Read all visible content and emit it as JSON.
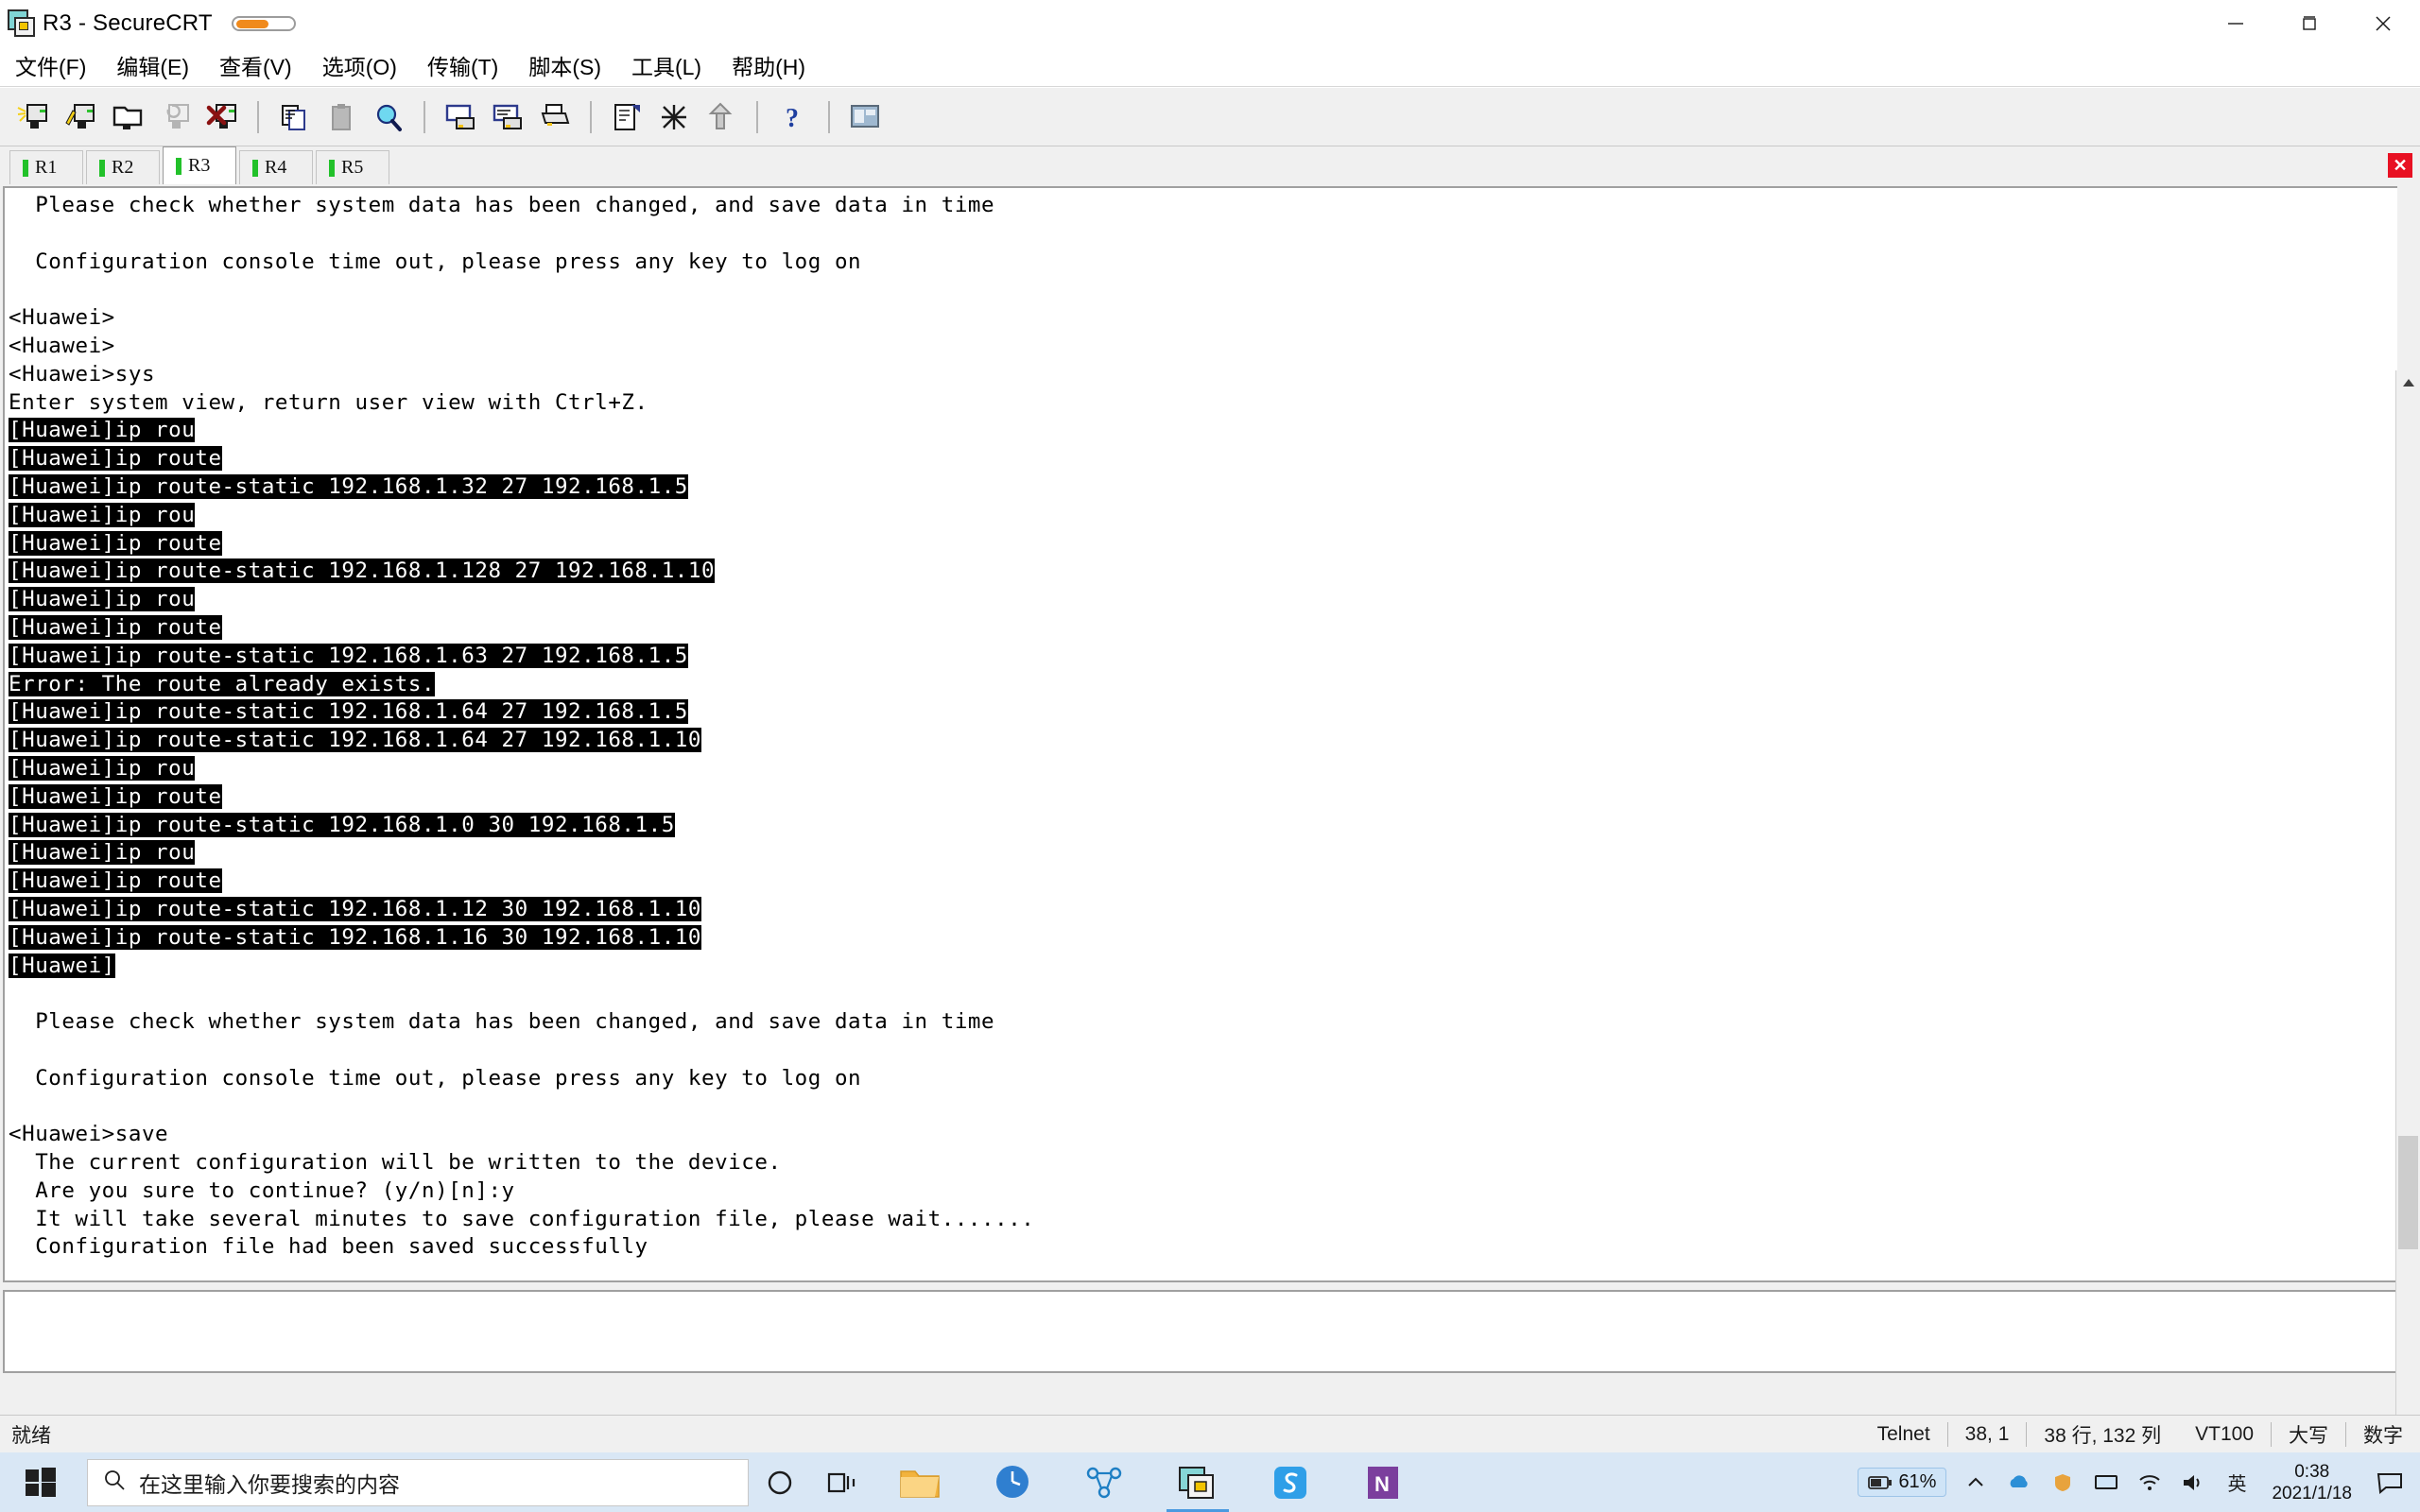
{
  "window": {
    "title": "R3 - SecureCRT",
    "app_icon": "securecrt-icon",
    "minimize": "—",
    "maximize": "❐",
    "close": "✕"
  },
  "menubar": {
    "items": [
      {
        "label": "文件(F)",
        "name": "menu-file"
      },
      {
        "label": "编辑(E)",
        "name": "menu-edit"
      },
      {
        "label": "查看(V)",
        "name": "menu-view"
      },
      {
        "label": "选项(O)",
        "name": "menu-options"
      },
      {
        "label": "传输(T)",
        "name": "menu-transfer"
      },
      {
        "label": "脚本(S)",
        "name": "menu-script"
      },
      {
        "label": "工具(L)",
        "name": "menu-tools"
      },
      {
        "label": "帮助(H)",
        "name": "menu-help"
      }
    ]
  },
  "toolbar": {
    "buttons": [
      "new-session-icon",
      "quick-connect-icon",
      "open-session-folder-icon",
      "reconnect-icon",
      "disconnect-icon",
      "copy-icon",
      "paste-icon",
      "find-icon",
      "log-session-icon",
      "print-screen-icon",
      "print-icon",
      "session-options-icon",
      "global-options-icon",
      "upload-icon",
      "help-icon",
      "tile-windows-icon"
    ]
  },
  "tabs": {
    "items": [
      {
        "label": "R1",
        "active": false
      },
      {
        "label": "R2",
        "active": false
      },
      {
        "label": "R3",
        "active": true
      },
      {
        "label": "R4",
        "active": false
      },
      {
        "label": "R5",
        "active": false
      }
    ],
    "close_label": "✕"
  },
  "terminal": {
    "lines": [
      {
        "text": "  Please check whether system data has been changed, and save data in time",
        "inv": false
      },
      {
        "text": "",
        "inv": false
      },
      {
        "text": "  Configuration console time out, please press any key to log on",
        "inv": false
      },
      {
        "text": "",
        "inv": false
      },
      {
        "text": "<Huawei>",
        "inv": false
      },
      {
        "text": "<Huawei>",
        "inv": false
      },
      {
        "text": "<Huawei>sys",
        "inv": false
      },
      {
        "text": "Enter system view, return user view with Ctrl+Z.",
        "inv": false
      },
      {
        "text": "[Huawei]ip rou",
        "inv": true
      },
      {
        "text": "[Huawei]ip route",
        "inv": true
      },
      {
        "text": "[Huawei]ip route-static 192.168.1.32 27 192.168.1.5",
        "inv": true
      },
      {
        "text": "[Huawei]ip rou",
        "inv": true
      },
      {
        "text": "[Huawei]ip route",
        "inv": true
      },
      {
        "text": "[Huawei]ip route-static 192.168.1.128 27 192.168.1.10",
        "inv": true
      },
      {
        "text": "[Huawei]ip rou",
        "inv": true
      },
      {
        "text": "[Huawei]ip route",
        "inv": true
      },
      {
        "text": "[Huawei]ip route-static 192.168.1.63 27 192.168.1.5",
        "inv": true
      },
      {
        "text": "Error: The route already exists.",
        "inv": true
      },
      {
        "text": "[Huawei]ip route-static 192.168.1.64 27 192.168.1.5",
        "inv": true
      },
      {
        "text": "[Huawei]ip route-static 192.168.1.64 27 192.168.1.10",
        "inv": true
      },
      {
        "text": "[Huawei]ip rou",
        "inv": true
      },
      {
        "text": "[Huawei]ip route",
        "inv": true
      },
      {
        "text": "[Huawei]ip route-static 192.168.1.0 30 192.168.1.5",
        "inv": true
      },
      {
        "text": "[Huawei]ip rou",
        "inv": true
      },
      {
        "text": "[Huawei]ip route",
        "inv": true
      },
      {
        "text": "[Huawei]ip route-static 192.168.1.12 30 192.168.1.10",
        "inv": true
      },
      {
        "text": "[Huawei]ip route-static 192.168.1.16 30 192.168.1.10",
        "inv": true
      },
      {
        "text": "[Huawei]",
        "inv": true
      },
      {
        "text": "",
        "inv": false
      },
      {
        "text": "  Please check whether system data has been changed, and save data in time",
        "inv": false
      },
      {
        "text": "",
        "inv": false
      },
      {
        "text": "  Configuration console time out, please press any key to log on",
        "inv": false
      },
      {
        "text": "",
        "inv": false
      },
      {
        "text": "<Huawei>save",
        "inv": false
      },
      {
        "text": "  The current configuration will be written to the device.",
        "inv": false
      },
      {
        "text": "  Are you sure to continue? (y/n)[n]:y",
        "inv": false
      },
      {
        "text": "  It will take several minutes to save configuration file, please wait.......",
        "inv": false
      },
      {
        "text": "  Configuration file had been saved successfully",
        "inv": false
      }
    ]
  },
  "statusbar": {
    "ready": "就绪",
    "protocol": "Telnet",
    "cursor": "38,  1",
    "dimensions": "38 行, 132 列",
    "emulation": "VT100",
    "caps": "大写",
    "num": "数字"
  },
  "taskbar": {
    "start": "windows-start-icon",
    "search_placeholder": "在这里输入你要搜索的内容",
    "cortana": "cortana-icon",
    "taskview": "task-view-icon",
    "apps": [
      {
        "name": "file-explorer-icon",
        "active": false
      },
      {
        "name": "clock-app-icon",
        "active": false
      },
      {
        "name": "ensp-icon",
        "active": false
      },
      {
        "name": "securecrt-icon",
        "active": true
      },
      {
        "name": "snipaste-icon",
        "active": false
      },
      {
        "name": "onenote-icon",
        "active": false
      }
    ],
    "battery_percent": "61%",
    "ime": "英",
    "time": "0:38",
    "date": "2021/1/18"
  },
  "colors": {
    "accent": "#f08a1c",
    "tab_led": "#22c12a",
    "close_red": "#e81123",
    "taskbar_bg": "#d9e7f5",
    "terminal_bg": "#ffffff",
    "terminal_fg": "#000000",
    "terminal_inverse_bg": "#000000"
  }
}
